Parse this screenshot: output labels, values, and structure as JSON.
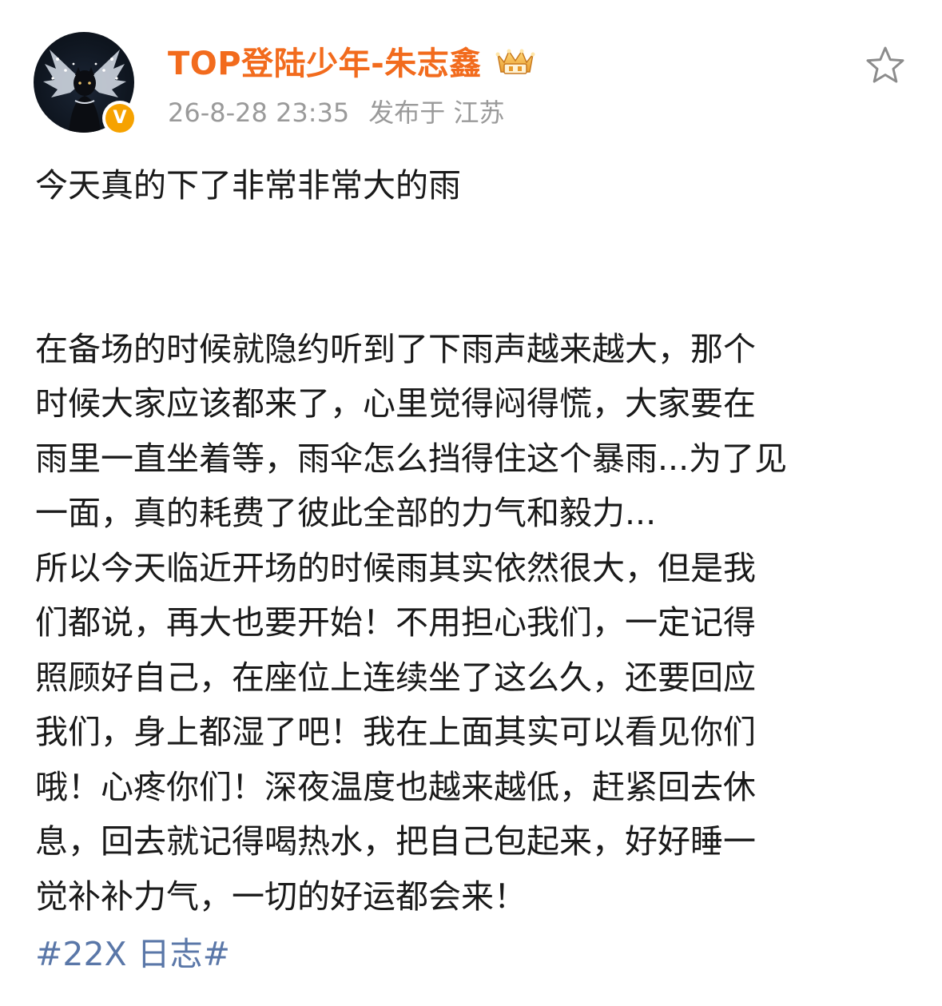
{
  "post": {
    "author": {
      "name": "TOP登陆少年-朱志鑫",
      "verified_mark": "V"
    },
    "meta": {
      "timestamp": "26-8-28 23:35",
      "location": "发布于 江苏"
    },
    "paragraphs": {
      "p1": [
        "今天真的下了非常非常大的雨"
      ],
      "p2": [
        "在备场的时候就隐约听到了下雨声越来越大，那个",
        "时候大家应该都来了，心里觉得闷得慌，大家要在",
        "雨里一直坐着等，雨伞怎么挡得住这个暴雨...为了见",
        "一面，真的耗费了彼此全部的力气和毅力...",
        "所以今天临近开场的时候雨其实依然很大，但是我",
        "们都说，再大也要开始！不用担心我们，一定记得",
        "照顾好自己，在座位上连续坐了这么久，还要回应",
        "我们，身上都湿了吧！我在上面其实可以看见你们",
        "哦！心疼你们！深夜温度也越来越低，赶紧回去休",
        "息，回去就记得喝热水，把自己包起来，好好睡一",
        "觉补补力气，一切的好运都会来！"
      ]
    },
    "hashtag": "#22X 日志#"
  },
  "colors": {
    "username": "#f26b1d",
    "meta": "#9a9a9a",
    "body_text": "#1a1a1a",
    "hashtag": "#5a77a8",
    "verified_badge": "#f6a200"
  },
  "icons": {
    "avatar": "avatar-image",
    "verified": "verified-v-icon",
    "crown": "crown-badge-icon",
    "favorite": "star-outline-icon"
  }
}
